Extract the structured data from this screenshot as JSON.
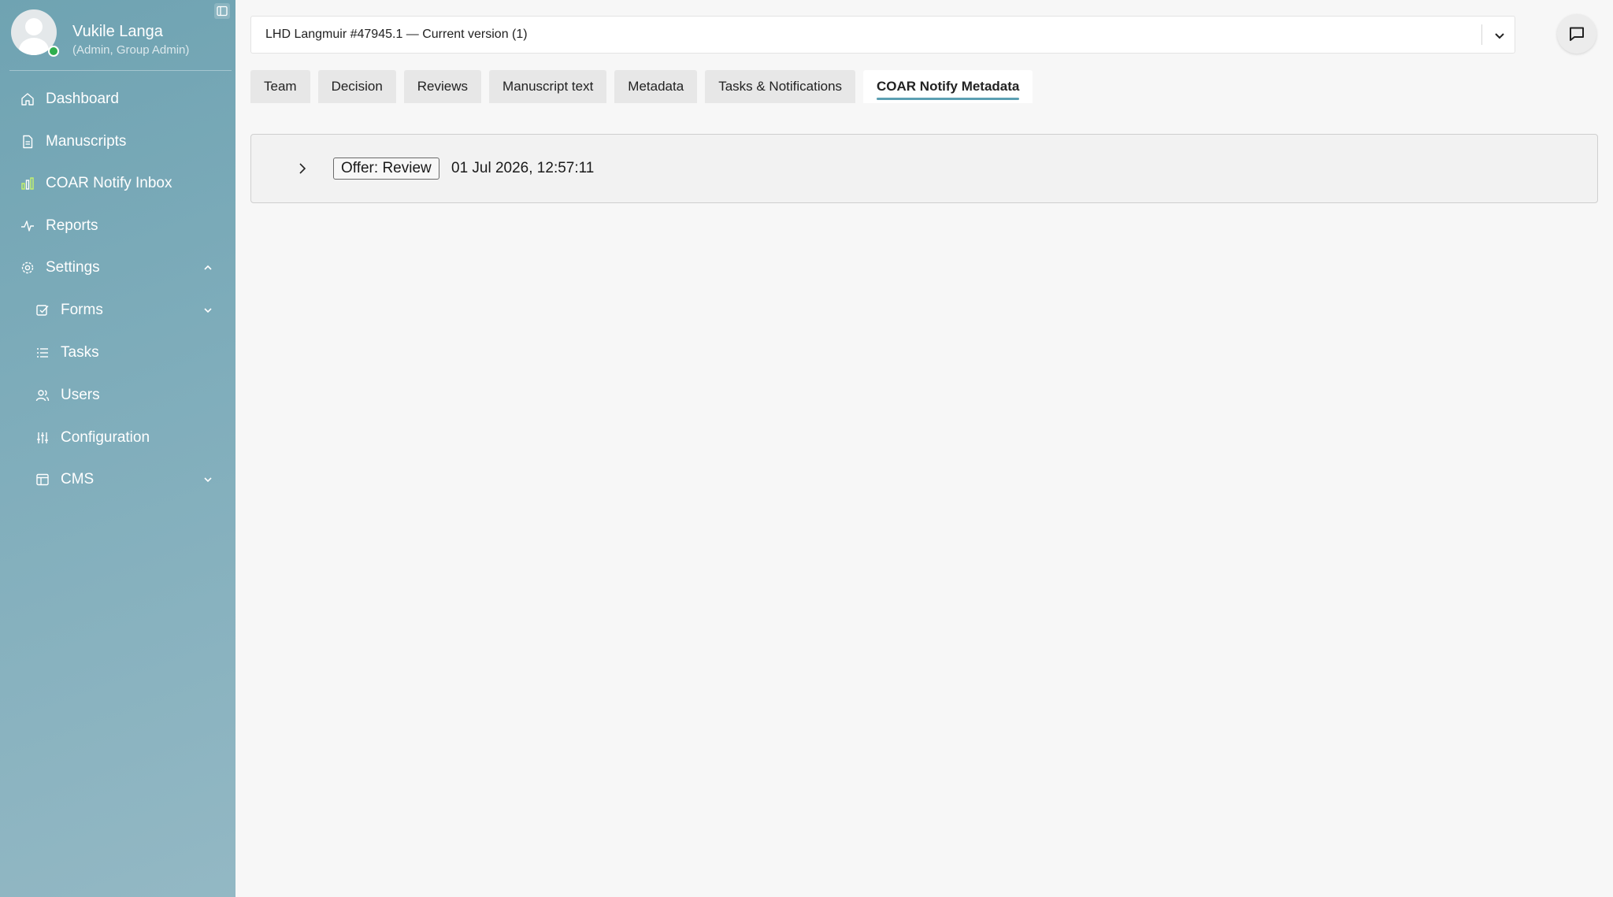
{
  "user": {
    "name": "Vukile Langa",
    "role": "(Admin, Group Admin)",
    "status_color": "#2fae4e"
  },
  "sidebar": {
    "items": [
      {
        "label": "Dashboard",
        "icon": "home-icon"
      },
      {
        "label": "Manuscripts",
        "icon": "document-icon"
      },
      {
        "label": "COAR Notify Inbox",
        "icon": "inbox-chart-icon"
      },
      {
        "label": "Reports",
        "icon": "activity-icon"
      },
      {
        "label": "Settings",
        "icon": "gear-icon",
        "expanded": true
      },
      {
        "label": "Forms",
        "icon": "checkbox-icon",
        "expanded": false
      },
      {
        "label": "Tasks",
        "icon": "list-icon"
      },
      {
        "label": "Users",
        "icon": "users-icon"
      },
      {
        "label": "Configuration",
        "icon": "sliders-icon"
      },
      {
        "label": "CMS",
        "icon": "layout-icon",
        "expanded": false
      }
    ]
  },
  "header": {
    "version_title": "LHD Langmuir #47945.1   — Current version (1)"
  },
  "tabs": [
    {
      "label": "Team"
    },
    {
      "label": "Decision"
    },
    {
      "label": "Reviews"
    },
    {
      "label": "Manuscript text"
    },
    {
      "label": "Metadata"
    },
    {
      "label": "Tasks & Notifications"
    },
    {
      "label": "COAR Notify Metadata",
      "active": true
    }
  ],
  "notification": {
    "type": "Offer: Review",
    "timestamp": "01 Jul 2026, 12:57:11"
  },
  "colors": {
    "accent": "#5b9fb2",
    "sidebar_start": "#6fa3b2",
    "sidebar_end": "#93b8c4"
  }
}
